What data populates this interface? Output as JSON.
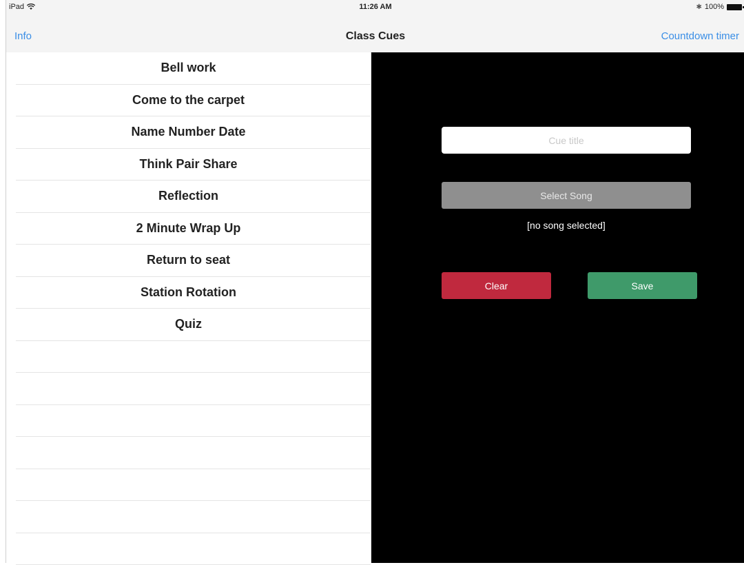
{
  "status_bar": {
    "device": "iPad",
    "time": "11:26 AM",
    "battery": "100%"
  },
  "nav": {
    "left_label": "Info",
    "title": "Class Cues",
    "right_label": "Countdown timer"
  },
  "cues": [
    "Bell work",
    "Come to the carpet",
    "Name Number Date",
    "Think Pair Share",
    "Reflection",
    "2 Minute Wrap Up",
    "Return to seat",
    "Station Rotation",
    "Quiz"
  ],
  "editor": {
    "title_placeholder": "Cue title",
    "title_value": "",
    "select_song_label": "Select Song",
    "song_status": "[no song selected]",
    "clear_label": "Clear",
    "save_label": "Save"
  },
  "colors": {
    "accent": "#3a8ee6",
    "clear": "#c0293e",
    "save": "#3f9a6a",
    "select_song": "#8f8f8f"
  }
}
